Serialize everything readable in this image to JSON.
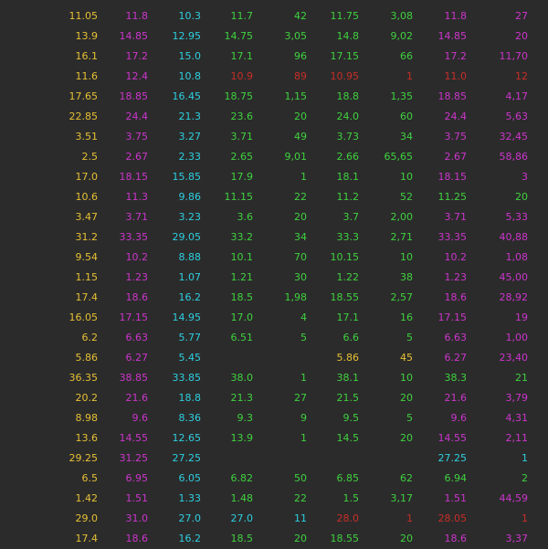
{
  "colors": {
    "y": "#e6c034",
    "m": "#cc35cc",
    "c": "#2dcfe0",
    "g": "#3fd23f",
    "r": "#c92d28"
  },
  "rows": [
    [
      {
        "t": "11.05",
        "c": "y"
      },
      {
        "t": "11.8",
        "c": "m"
      },
      {
        "t": "10.3",
        "c": "c"
      },
      {
        "t": "11.7",
        "c": "g"
      },
      {
        "t": "42",
        "c": "g"
      },
      {
        "t": "11.75",
        "c": "g"
      },
      {
        "t": "3,08",
        "c": "g"
      },
      {
        "t": "11.8",
        "c": "m"
      },
      {
        "t": "27",
        "c": "m"
      }
    ],
    [
      {
        "t": "13.9",
        "c": "y"
      },
      {
        "t": "14.85",
        "c": "m"
      },
      {
        "t": "12.95",
        "c": "c"
      },
      {
        "t": "14.75",
        "c": "g"
      },
      {
        "t": "3,05",
        "c": "g"
      },
      {
        "t": "14.8",
        "c": "g"
      },
      {
        "t": "9,02",
        "c": "g"
      },
      {
        "t": "14.85",
        "c": "m"
      },
      {
        "t": "20",
        "c": "m"
      }
    ],
    [
      {
        "t": "16.1",
        "c": "y"
      },
      {
        "t": "17.2",
        "c": "m"
      },
      {
        "t": "15.0",
        "c": "c"
      },
      {
        "t": "17.1",
        "c": "g"
      },
      {
        "t": "96",
        "c": "g"
      },
      {
        "t": "17.15",
        "c": "g"
      },
      {
        "t": "66",
        "c": "g"
      },
      {
        "t": "17.2",
        "c": "m"
      },
      {
        "t": "11,70",
        "c": "m"
      }
    ],
    [
      {
        "t": "11.6",
        "c": "y"
      },
      {
        "t": "12.4",
        "c": "m"
      },
      {
        "t": "10.8",
        "c": "c"
      },
      {
        "t": "10.9",
        "c": "r"
      },
      {
        "t": "89",
        "c": "r"
      },
      {
        "t": "10.95",
        "c": "r"
      },
      {
        "t": "1",
        "c": "r"
      },
      {
        "t": "11.0",
        "c": "r"
      },
      {
        "t": "12",
        "c": "r"
      }
    ],
    [
      {
        "t": "17.65",
        "c": "y"
      },
      {
        "t": "18.85",
        "c": "m"
      },
      {
        "t": "16.45",
        "c": "c"
      },
      {
        "t": "18.75",
        "c": "g"
      },
      {
        "t": "1,15",
        "c": "g"
      },
      {
        "t": "18.8",
        "c": "g"
      },
      {
        "t": "1,35",
        "c": "g"
      },
      {
        "t": "18.85",
        "c": "m"
      },
      {
        "t": "4,17",
        "c": "m"
      }
    ],
    [
      {
        "t": "22.85",
        "c": "y"
      },
      {
        "t": "24.4",
        "c": "m"
      },
      {
        "t": "21.3",
        "c": "c"
      },
      {
        "t": "23.6",
        "c": "g"
      },
      {
        "t": "20",
        "c": "g"
      },
      {
        "t": "24.0",
        "c": "g"
      },
      {
        "t": "60",
        "c": "g"
      },
      {
        "t": "24.4",
        "c": "m"
      },
      {
        "t": "5,63",
        "c": "m"
      }
    ],
    [
      {
        "t": "3.51",
        "c": "y"
      },
      {
        "t": "3.75",
        "c": "m"
      },
      {
        "t": "3.27",
        "c": "c"
      },
      {
        "t": "3.71",
        "c": "g"
      },
      {
        "t": "49",
        "c": "g"
      },
      {
        "t": "3.73",
        "c": "g"
      },
      {
        "t": "34",
        "c": "g"
      },
      {
        "t": "3.75",
        "c": "m"
      },
      {
        "t": "32,45",
        "c": "m"
      }
    ],
    [
      {
        "t": "2.5",
        "c": "y"
      },
      {
        "t": "2.67",
        "c": "m"
      },
      {
        "t": "2.33",
        "c": "c"
      },
      {
        "t": "2.65",
        "c": "g"
      },
      {
        "t": "9,01",
        "c": "g"
      },
      {
        "t": "2.66",
        "c": "g"
      },
      {
        "t": "65,65",
        "c": "g"
      },
      {
        "t": "2.67",
        "c": "m"
      },
      {
        "t": "58,86",
        "c": "m"
      }
    ],
    [
      {
        "t": "17.0",
        "c": "y"
      },
      {
        "t": "18.15",
        "c": "m"
      },
      {
        "t": "15.85",
        "c": "c"
      },
      {
        "t": "17.9",
        "c": "g"
      },
      {
        "t": "1",
        "c": "g"
      },
      {
        "t": "18.1",
        "c": "g"
      },
      {
        "t": "10",
        "c": "g"
      },
      {
        "t": "18.15",
        "c": "m"
      },
      {
        "t": "3",
        "c": "m"
      }
    ],
    [
      {
        "t": "10.6",
        "c": "y"
      },
      {
        "t": "11.3",
        "c": "m"
      },
      {
        "t": "9.86",
        "c": "c"
      },
      {
        "t": "11.15",
        "c": "g"
      },
      {
        "t": "22",
        "c": "g"
      },
      {
        "t": "11.2",
        "c": "g"
      },
      {
        "t": "52",
        "c": "g"
      },
      {
        "t": "11.25",
        "c": "g"
      },
      {
        "t": "20",
        "c": "g"
      }
    ],
    [
      {
        "t": "3.47",
        "c": "y"
      },
      {
        "t": "3.71",
        "c": "m"
      },
      {
        "t": "3.23",
        "c": "c"
      },
      {
        "t": "3.6",
        "c": "g"
      },
      {
        "t": "20",
        "c": "g"
      },
      {
        "t": "3.7",
        "c": "g"
      },
      {
        "t": "2,00",
        "c": "g"
      },
      {
        "t": "3.71",
        "c": "m"
      },
      {
        "t": "5,33",
        "c": "m"
      }
    ],
    [
      {
        "t": "31.2",
        "c": "y"
      },
      {
        "t": "33.35",
        "c": "m"
      },
      {
        "t": "29.05",
        "c": "c"
      },
      {
        "t": "33.2",
        "c": "g"
      },
      {
        "t": "34",
        "c": "g"
      },
      {
        "t": "33.3",
        "c": "g"
      },
      {
        "t": "2,71",
        "c": "g"
      },
      {
        "t": "33.35",
        "c": "m"
      },
      {
        "t": "40,88",
        "c": "m"
      }
    ],
    [
      {
        "t": "9.54",
        "c": "y"
      },
      {
        "t": "10.2",
        "c": "m"
      },
      {
        "t": "8.88",
        "c": "c"
      },
      {
        "t": "10.1",
        "c": "g"
      },
      {
        "t": "70",
        "c": "g"
      },
      {
        "t": "10.15",
        "c": "g"
      },
      {
        "t": "10",
        "c": "g"
      },
      {
        "t": "10.2",
        "c": "m"
      },
      {
        "t": "1,08",
        "c": "m"
      }
    ],
    [
      {
        "t": "1.15",
        "c": "y"
      },
      {
        "t": "1.23",
        "c": "m"
      },
      {
        "t": "1.07",
        "c": "c"
      },
      {
        "t": "1.21",
        "c": "g"
      },
      {
        "t": "30",
        "c": "g"
      },
      {
        "t": "1.22",
        "c": "g"
      },
      {
        "t": "38",
        "c": "g"
      },
      {
        "t": "1.23",
        "c": "m"
      },
      {
        "t": "45,00",
        "c": "m"
      }
    ],
    [
      {
        "t": "17.4",
        "c": "y"
      },
      {
        "t": "18.6",
        "c": "m"
      },
      {
        "t": "16.2",
        "c": "c"
      },
      {
        "t": "18.5",
        "c": "g"
      },
      {
        "t": "1,98",
        "c": "g"
      },
      {
        "t": "18.55",
        "c": "g"
      },
      {
        "t": "2,57",
        "c": "g"
      },
      {
        "t": "18.6",
        "c": "m"
      },
      {
        "t": "28,92",
        "c": "m"
      }
    ],
    [
      {
        "t": "16.05",
        "c": "y"
      },
      {
        "t": "17.15",
        "c": "m"
      },
      {
        "t": "14.95",
        "c": "c"
      },
      {
        "t": "17.0",
        "c": "g"
      },
      {
        "t": "4",
        "c": "g"
      },
      {
        "t": "17.1",
        "c": "g"
      },
      {
        "t": "16",
        "c": "g"
      },
      {
        "t": "17.15",
        "c": "m"
      },
      {
        "t": "19",
        "c": "m"
      }
    ],
    [
      {
        "t": "6.2",
        "c": "y"
      },
      {
        "t": "6.63",
        "c": "m"
      },
      {
        "t": "5.77",
        "c": "c"
      },
      {
        "t": "6.51",
        "c": "g"
      },
      {
        "t": "5",
        "c": "g"
      },
      {
        "t": "6.6",
        "c": "g"
      },
      {
        "t": "5",
        "c": "g"
      },
      {
        "t": "6.63",
        "c": "m"
      },
      {
        "t": "1,00",
        "c": "m"
      }
    ],
    [
      {
        "t": "5.86",
        "c": "y"
      },
      {
        "t": "6.27",
        "c": "m"
      },
      {
        "t": "5.45",
        "c": "c"
      },
      null,
      null,
      {
        "t": "5.86",
        "c": "y"
      },
      {
        "t": "45",
        "c": "y"
      },
      {
        "t": "6.27",
        "c": "m"
      },
      {
        "t": "23,40",
        "c": "m"
      }
    ],
    [
      {
        "t": "36.35",
        "c": "y"
      },
      {
        "t": "38.85",
        "c": "m"
      },
      {
        "t": "33.85",
        "c": "c"
      },
      {
        "t": "38.0",
        "c": "g"
      },
      {
        "t": "1",
        "c": "g"
      },
      {
        "t": "38.1",
        "c": "g"
      },
      {
        "t": "10",
        "c": "g"
      },
      {
        "t": "38.3",
        "c": "g"
      },
      {
        "t": "21",
        "c": "g"
      }
    ],
    [
      {
        "t": "20.2",
        "c": "y"
      },
      {
        "t": "21.6",
        "c": "m"
      },
      {
        "t": "18.8",
        "c": "c"
      },
      {
        "t": "21.3",
        "c": "g"
      },
      {
        "t": "27",
        "c": "g"
      },
      {
        "t": "21.5",
        "c": "g"
      },
      {
        "t": "20",
        "c": "g"
      },
      {
        "t": "21.6",
        "c": "m"
      },
      {
        "t": "3,79",
        "c": "m"
      }
    ],
    [
      {
        "t": "8.98",
        "c": "y"
      },
      {
        "t": "9.6",
        "c": "m"
      },
      {
        "t": "8.36",
        "c": "c"
      },
      {
        "t": "9.3",
        "c": "g"
      },
      {
        "t": "9",
        "c": "g"
      },
      {
        "t": "9.5",
        "c": "g"
      },
      {
        "t": "5",
        "c": "g"
      },
      {
        "t": "9.6",
        "c": "m"
      },
      {
        "t": "4,31",
        "c": "m"
      }
    ],
    [
      {
        "t": "13.6",
        "c": "y"
      },
      {
        "t": "14.55",
        "c": "m"
      },
      {
        "t": "12.65",
        "c": "c"
      },
      {
        "t": "13.9",
        "c": "g"
      },
      {
        "t": "1",
        "c": "g"
      },
      {
        "t": "14.5",
        "c": "g"
      },
      {
        "t": "20",
        "c": "g"
      },
      {
        "t": "14.55",
        "c": "m"
      },
      {
        "t": "2,11",
        "c": "m"
      }
    ],
    [
      {
        "t": "29.25",
        "c": "y"
      },
      {
        "t": "31.25",
        "c": "m"
      },
      {
        "t": "27.25",
        "c": "c"
      },
      null,
      null,
      null,
      null,
      {
        "t": "27.25",
        "c": "c"
      },
      {
        "t": "1",
        "c": "c"
      }
    ],
    [
      {
        "t": "6.5",
        "c": "y"
      },
      {
        "t": "6.95",
        "c": "m"
      },
      {
        "t": "6.05",
        "c": "c"
      },
      {
        "t": "6.82",
        "c": "g"
      },
      {
        "t": "50",
        "c": "g"
      },
      {
        "t": "6.85",
        "c": "g"
      },
      {
        "t": "62",
        "c": "g"
      },
      {
        "t": "6.94",
        "c": "g"
      },
      {
        "t": "2",
        "c": "g"
      }
    ],
    [
      {
        "t": "1.42",
        "c": "y"
      },
      {
        "t": "1.51",
        "c": "m"
      },
      {
        "t": "1.33",
        "c": "c"
      },
      {
        "t": "1.48",
        "c": "g"
      },
      {
        "t": "22",
        "c": "g"
      },
      {
        "t": "1.5",
        "c": "g"
      },
      {
        "t": "3,17",
        "c": "g"
      },
      {
        "t": "1.51",
        "c": "m"
      },
      {
        "t": "44,59",
        "c": "m"
      }
    ],
    [
      {
        "t": "29.0",
        "c": "y"
      },
      {
        "t": "31.0",
        "c": "m"
      },
      {
        "t": "27.0",
        "c": "c"
      },
      {
        "t": "27.0",
        "c": "c"
      },
      {
        "t": "11",
        "c": "c"
      },
      {
        "t": "28.0",
        "c": "r"
      },
      {
        "t": "1",
        "c": "r"
      },
      {
        "t": "28.05",
        "c": "r"
      },
      {
        "t": "1",
        "c": "r"
      }
    ],
    [
      {
        "t": "17.4",
        "c": "y"
      },
      {
        "t": "18.6",
        "c": "m"
      },
      {
        "t": "16.2",
        "c": "c"
      },
      {
        "t": "18.5",
        "c": "g"
      },
      {
        "t": "20",
        "c": "g"
      },
      {
        "t": "18.55",
        "c": "g"
      },
      {
        "t": "20",
        "c": "g"
      },
      {
        "t": "18.6",
        "c": "m"
      },
      {
        "t": "3,37",
        "c": "m"
      }
    ]
  ]
}
